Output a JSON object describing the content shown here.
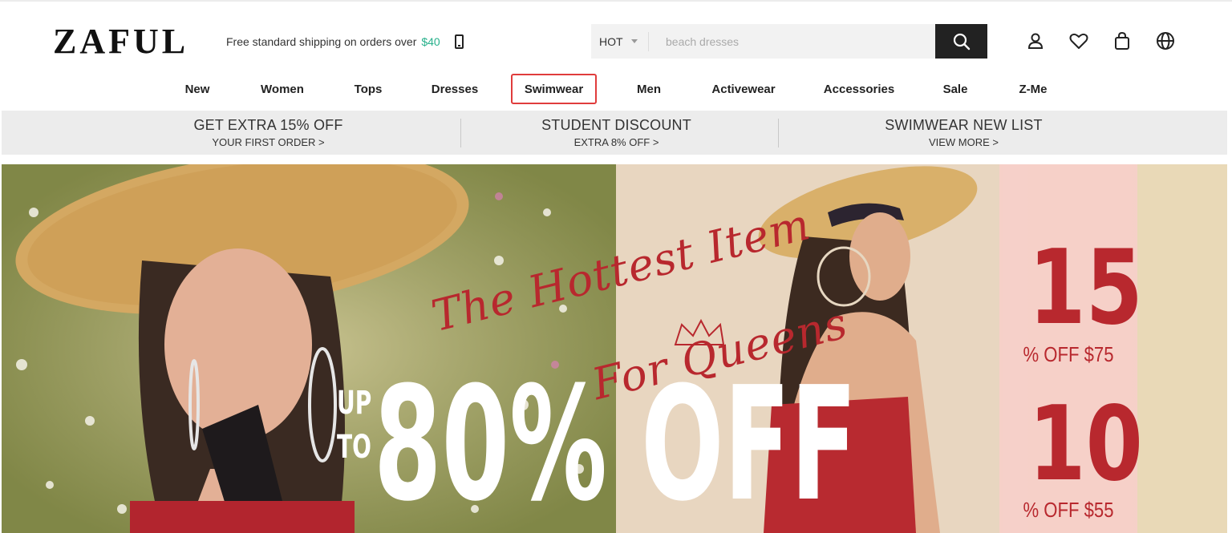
{
  "header": {
    "logo": "ZAFUL",
    "shipping_text": "Free standard shipping on orders over",
    "shipping_price": "$40",
    "search": {
      "category": "HOT",
      "placeholder": "beach dresses"
    }
  },
  "icons": [
    "account-icon",
    "wishlist-heart-icon",
    "shopping-bag-icon",
    "globe-language-icon"
  ],
  "nav": {
    "items": [
      {
        "label": "New"
      },
      {
        "label": "Women"
      },
      {
        "label": "Tops"
      },
      {
        "label": "Dresses"
      },
      {
        "label": "Swimwear",
        "active": true
      },
      {
        "label": "Men"
      },
      {
        "label": "Activewear"
      },
      {
        "label": "Accessories"
      },
      {
        "label": "Sale"
      },
      {
        "label": "Z-Me"
      }
    ]
  },
  "promo": [
    {
      "title": "GET EXTRA 15% OFF",
      "sub": "YOUR FIRST ORDER >"
    },
    {
      "title": "STUDENT DISCOUNT",
      "sub": "EXTRA 8% OFF >"
    },
    {
      "title": "SWIMWEAR NEW LIST",
      "sub": "VIEW MORE >"
    }
  ],
  "banner": {
    "script_line1": "The Hottest Item",
    "script_line2": "For Queens",
    "up_to_1": "UP",
    "up_to_2": "TO",
    "headline": "80% OFF",
    "offer1_value": "15",
    "offer1_text": "% OFF $75",
    "offer2_value": "10",
    "offer2_text": "% OFF $55"
  },
  "colors": {
    "accent_green": "#27b08b",
    "active_border": "#e03c3c",
    "offer_red": "#b8282e"
  }
}
